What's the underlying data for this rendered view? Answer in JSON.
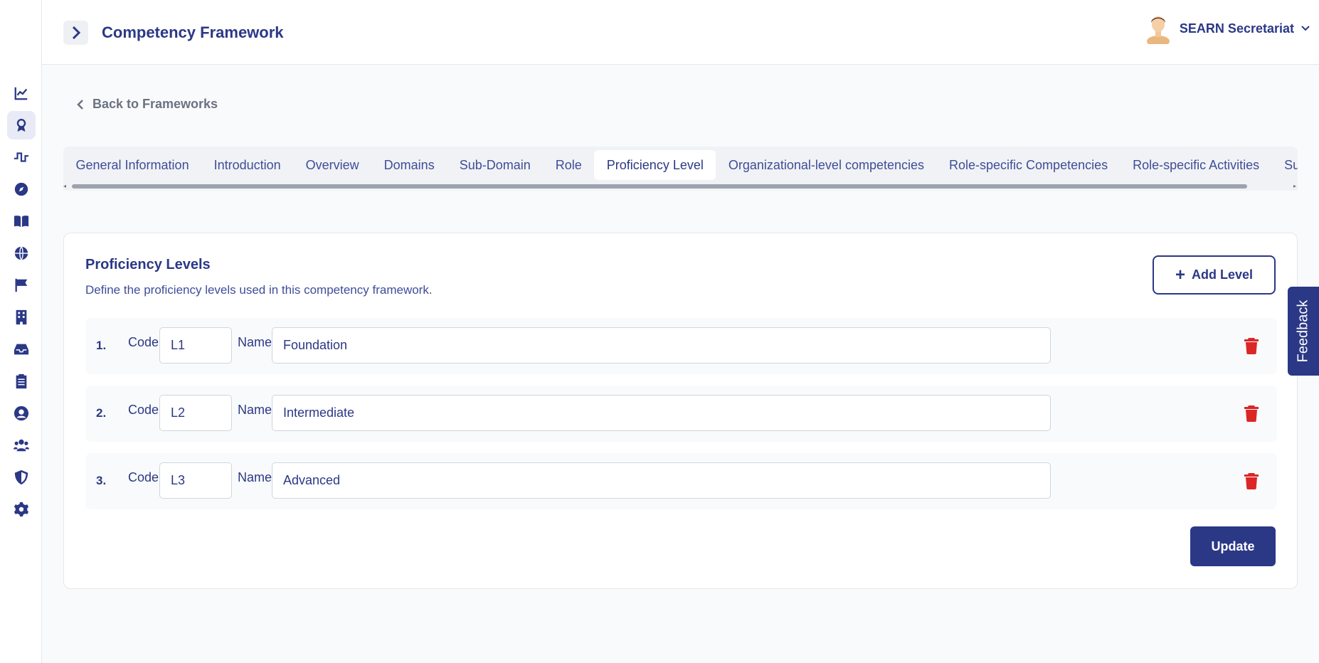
{
  "header": {
    "title": "Competency Framework",
    "user_name": "SEARN Secretariat"
  },
  "sidebar": {
    "items": [
      {
        "icon": "chart-line-icon",
        "active": false
      },
      {
        "icon": "award-icon",
        "active": true
      },
      {
        "icon": "wave-icon",
        "active": false
      },
      {
        "icon": "compass-icon",
        "active": false
      },
      {
        "icon": "book-icon",
        "active": false
      },
      {
        "icon": "globe-icon",
        "active": false
      },
      {
        "icon": "flag-icon",
        "active": false
      },
      {
        "icon": "building-icon",
        "active": false
      },
      {
        "icon": "inbox-icon",
        "active": false
      },
      {
        "icon": "clipboard-icon",
        "active": false
      },
      {
        "icon": "user-circle-icon",
        "active": false
      },
      {
        "icon": "users-icon",
        "active": false
      },
      {
        "icon": "shield-icon",
        "active": false
      },
      {
        "icon": "gear-icon",
        "active": false
      }
    ]
  },
  "back_link": "Back to Frameworks",
  "tabs": [
    {
      "label": "General Information"
    },
    {
      "label": "Introduction"
    },
    {
      "label": "Overview"
    },
    {
      "label": "Domains"
    },
    {
      "label": "Sub-Domain"
    },
    {
      "label": "Role"
    },
    {
      "label": "Proficiency Level",
      "active": true
    },
    {
      "label": "Organizational-level competencies"
    },
    {
      "label": "Role-specific Competencies"
    },
    {
      "label": "Role-specific Activities"
    },
    {
      "label": "Suggested Resources"
    }
  ],
  "card": {
    "title": "Proficiency Levels",
    "subtitle": "Define the proficiency levels used in this competency framework.",
    "add_label": "Add Level",
    "code_label": "Code",
    "name_label": "Name",
    "levels": [
      {
        "num": "1.",
        "code": "L1",
        "name": "Foundation"
      },
      {
        "num": "2.",
        "code": "L2",
        "name": "Intermediate"
      },
      {
        "num": "3.",
        "code": "L3",
        "name": "Advanced"
      }
    ],
    "update_label": "Update"
  },
  "feedback_label": "Feedback",
  "colors": {
    "primary": "#2b3886",
    "danger": "#dc2626"
  }
}
